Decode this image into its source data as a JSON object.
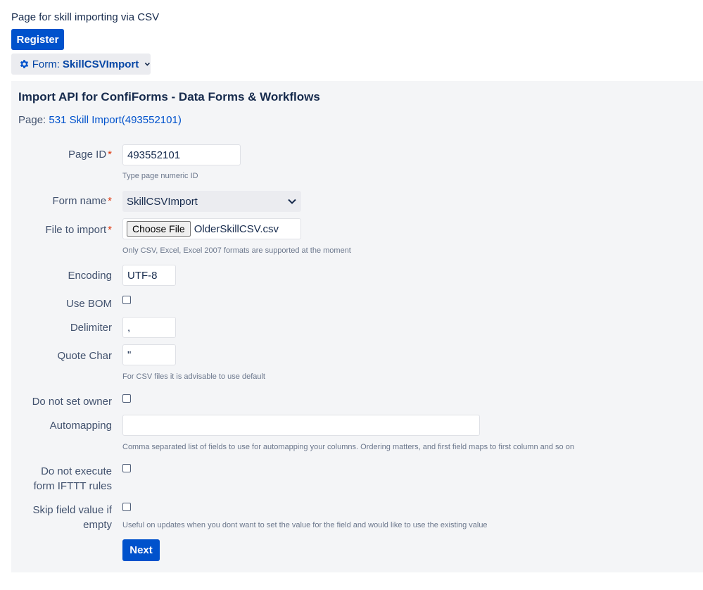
{
  "intro_text": "Page for skill importing via CSV",
  "register_label": "Register",
  "form_toggle": {
    "prefix": "Form:",
    "name": "SkillCSVImport"
  },
  "panel": {
    "title": "Import API for ConfiForms - Data Forms & Workflows",
    "page_prefix": "Page:",
    "page_link": "531 Skill Import(493552101)"
  },
  "fields": {
    "page_id": {
      "label": "Page ID",
      "required": "*",
      "value": "493552101",
      "hint": "Type page numeric ID"
    },
    "form_name": {
      "label": "Form name",
      "required": "*",
      "value": "SkillCSVImport"
    },
    "file": {
      "label": "File to import",
      "required": "*",
      "button": "Choose File",
      "filename": "OlderSkillCSV.csv",
      "hint": "Only CSV, Excel, Excel 2007 formats are supported at the moment"
    },
    "encoding": {
      "label": "Encoding",
      "value": "UTF-8"
    },
    "use_bom": {
      "label": "Use BOM",
      "checked": false
    },
    "delimiter": {
      "label": "Delimiter",
      "value": ","
    },
    "quote_char": {
      "label": "Quote Char",
      "value": "\"",
      "hint": "For CSV files it is advisable to use default"
    },
    "do_not_set_owner": {
      "label": "Do not set owner",
      "checked": false
    },
    "automapping": {
      "label": "Automapping",
      "value": "",
      "hint": "Comma separated list of fields to use for automapping your columns. Ordering matters, and first field maps to first column and so on"
    },
    "no_ifttt": {
      "label_line1": "Do not execute",
      "label_line2": "form IFTTT rules",
      "checked": false
    },
    "skip_empty": {
      "label_line1": "Skip field value if",
      "label_line2": "empty",
      "checked": false,
      "hint": "Useful on updates when you dont want to set the value for the field and would like to use the existing value"
    }
  },
  "next_label": "Next"
}
